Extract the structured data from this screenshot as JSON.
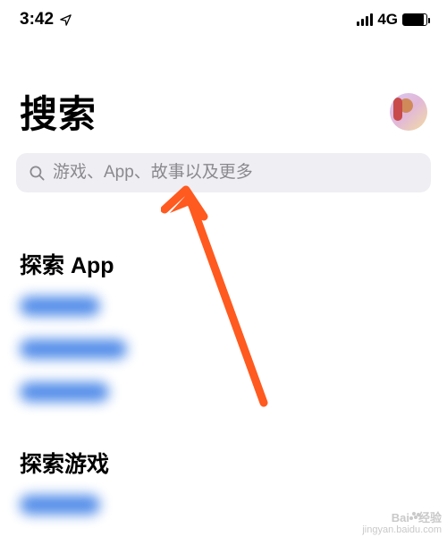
{
  "status": {
    "time": "3:42",
    "network_label": "4G"
  },
  "header": {
    "title": "搜索"
  },
  "search": {
    "placeholder": "游戏、App、故事以及更多"
  },
  "sections": [
    {
      "title": "探索 App",
      "item_widths": [
        90,
        120,
        100
      ]
    },
    {
      "title": "探索游戏",
      "item_widths": [
        90
      ]
    }
  ],
  "watermark": {
    "brand": "Bai",
    "brand2": "经验",
    "url": "jingyan.baidu.com"
  },
  "annotation": {
    "color": "#ff5a1f"
  }
}
